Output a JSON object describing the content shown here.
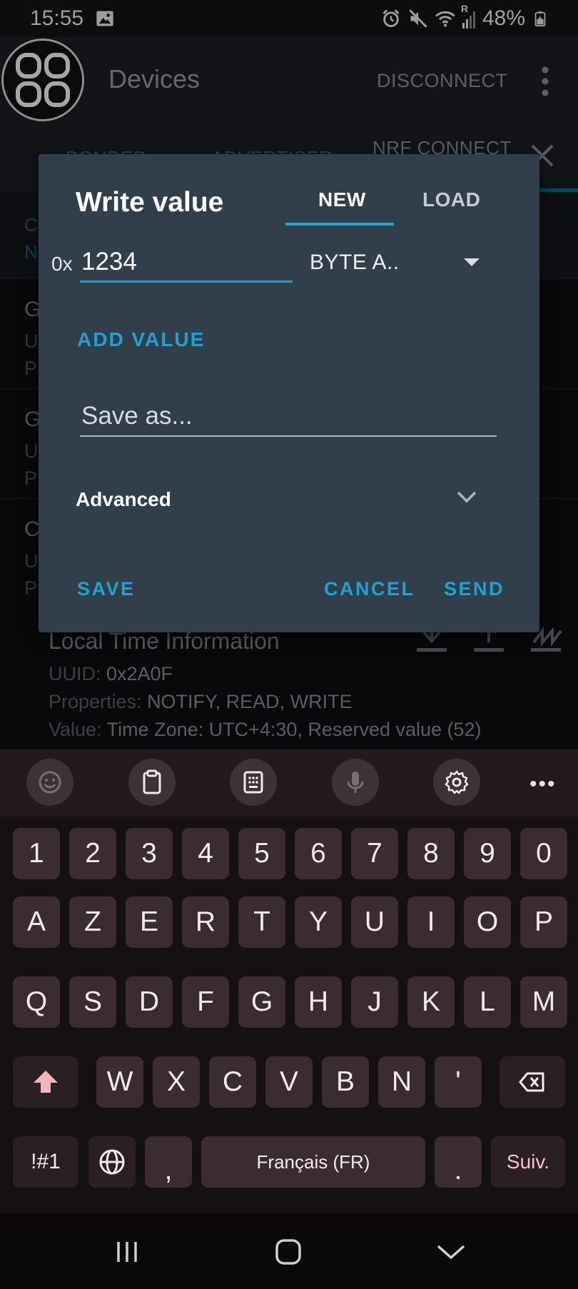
{
  "status_bar": {
    "time": "15:55",
    "signal_label": "R",
    "battery": "48%"
  },
  "toolbar": {
    "title": "Devices",
    "disconnect_label": "DISCONNECT"
  },
  "background_tabs": {
    "items": [
      "BONDED",
      "ADVERTISER",
      "NRF CONNECT"
    ]
  },
  "background_content": {
    "service_header": [
      "C",
      "N"
    ],
    "rows": [
      {
        "title": "G",
        "sub1": "U",
        "sub2": "P"
      },
      {
        "title": "G",
        "sub1": "U",
        "sub2": "P"
      },
      {
        "title": "C",
        "sub1": "U",
        "sub2": "P"
      }
    ],
    "characteristic": {
      "title": "Local Time Information",
      "uuid_label": "UUID: ",
      "uuid_value": "0x2A0F",
      "properties_label": "Properties: ",
      "properties_value": "NOTIFY, READ, WRITE",
      "value_label": "Value: ",
      "value_value": "Time Zone: UTC+4:30, Reserved value (52)"
    }
  },
  "dialog": {
    "title": "Write value",
    "tab_new": "NEW",
    "tab_load": "LOAD",
    "hex_prefix": "0x",
    "value": "1234",
    "type_selected": "BYTE A..",
    "add_value_label": "ADD VALUE",
    "save_as_placeholder": "Save as...",
    "advanced_label": "Advanced",
    "save_label": "SAVE",
    "cancel_label": "CANCEL",
    "send_label": "SEND"
  },
  "keyboard": {
    "row_numbers": [
      "1",
      "2",
      "3",
      "4",
      "5",
      "6",
      "7",
      "8",
      "9",
      "0"
    ],
    "row_1": [
      "A",
      "Z",
      "E",
      "R",
      "T",
      "Y",
      "U",
      "I",
      "O",
      "P"
    ],
    "row_2": [
      "Q",
      "S",
      "D",
      "F",
      "G",
      "H",
      "J",
      "K",
      "L",
      "M"
    ],
    "row_3": [
      "W",
      "X",
      "C",
      "V",
      "B",
      "N",
      "'"
    ],
    "symbols_label": "!#1",
    "comma_label": ",",
    "space_label": "Français (FR)",
    "period_label": ".",
    "next_label": "Suiv.",
    "more_label": "•••",
    "colors": {
      "shift_arrow": "#f3b4bd",
      "key_bg": "#3b2c31"
    }
  },
  "colors": {
    "accent": "#1aa4d0",
    "dialog_bg": "#323f4a"
  }
}
